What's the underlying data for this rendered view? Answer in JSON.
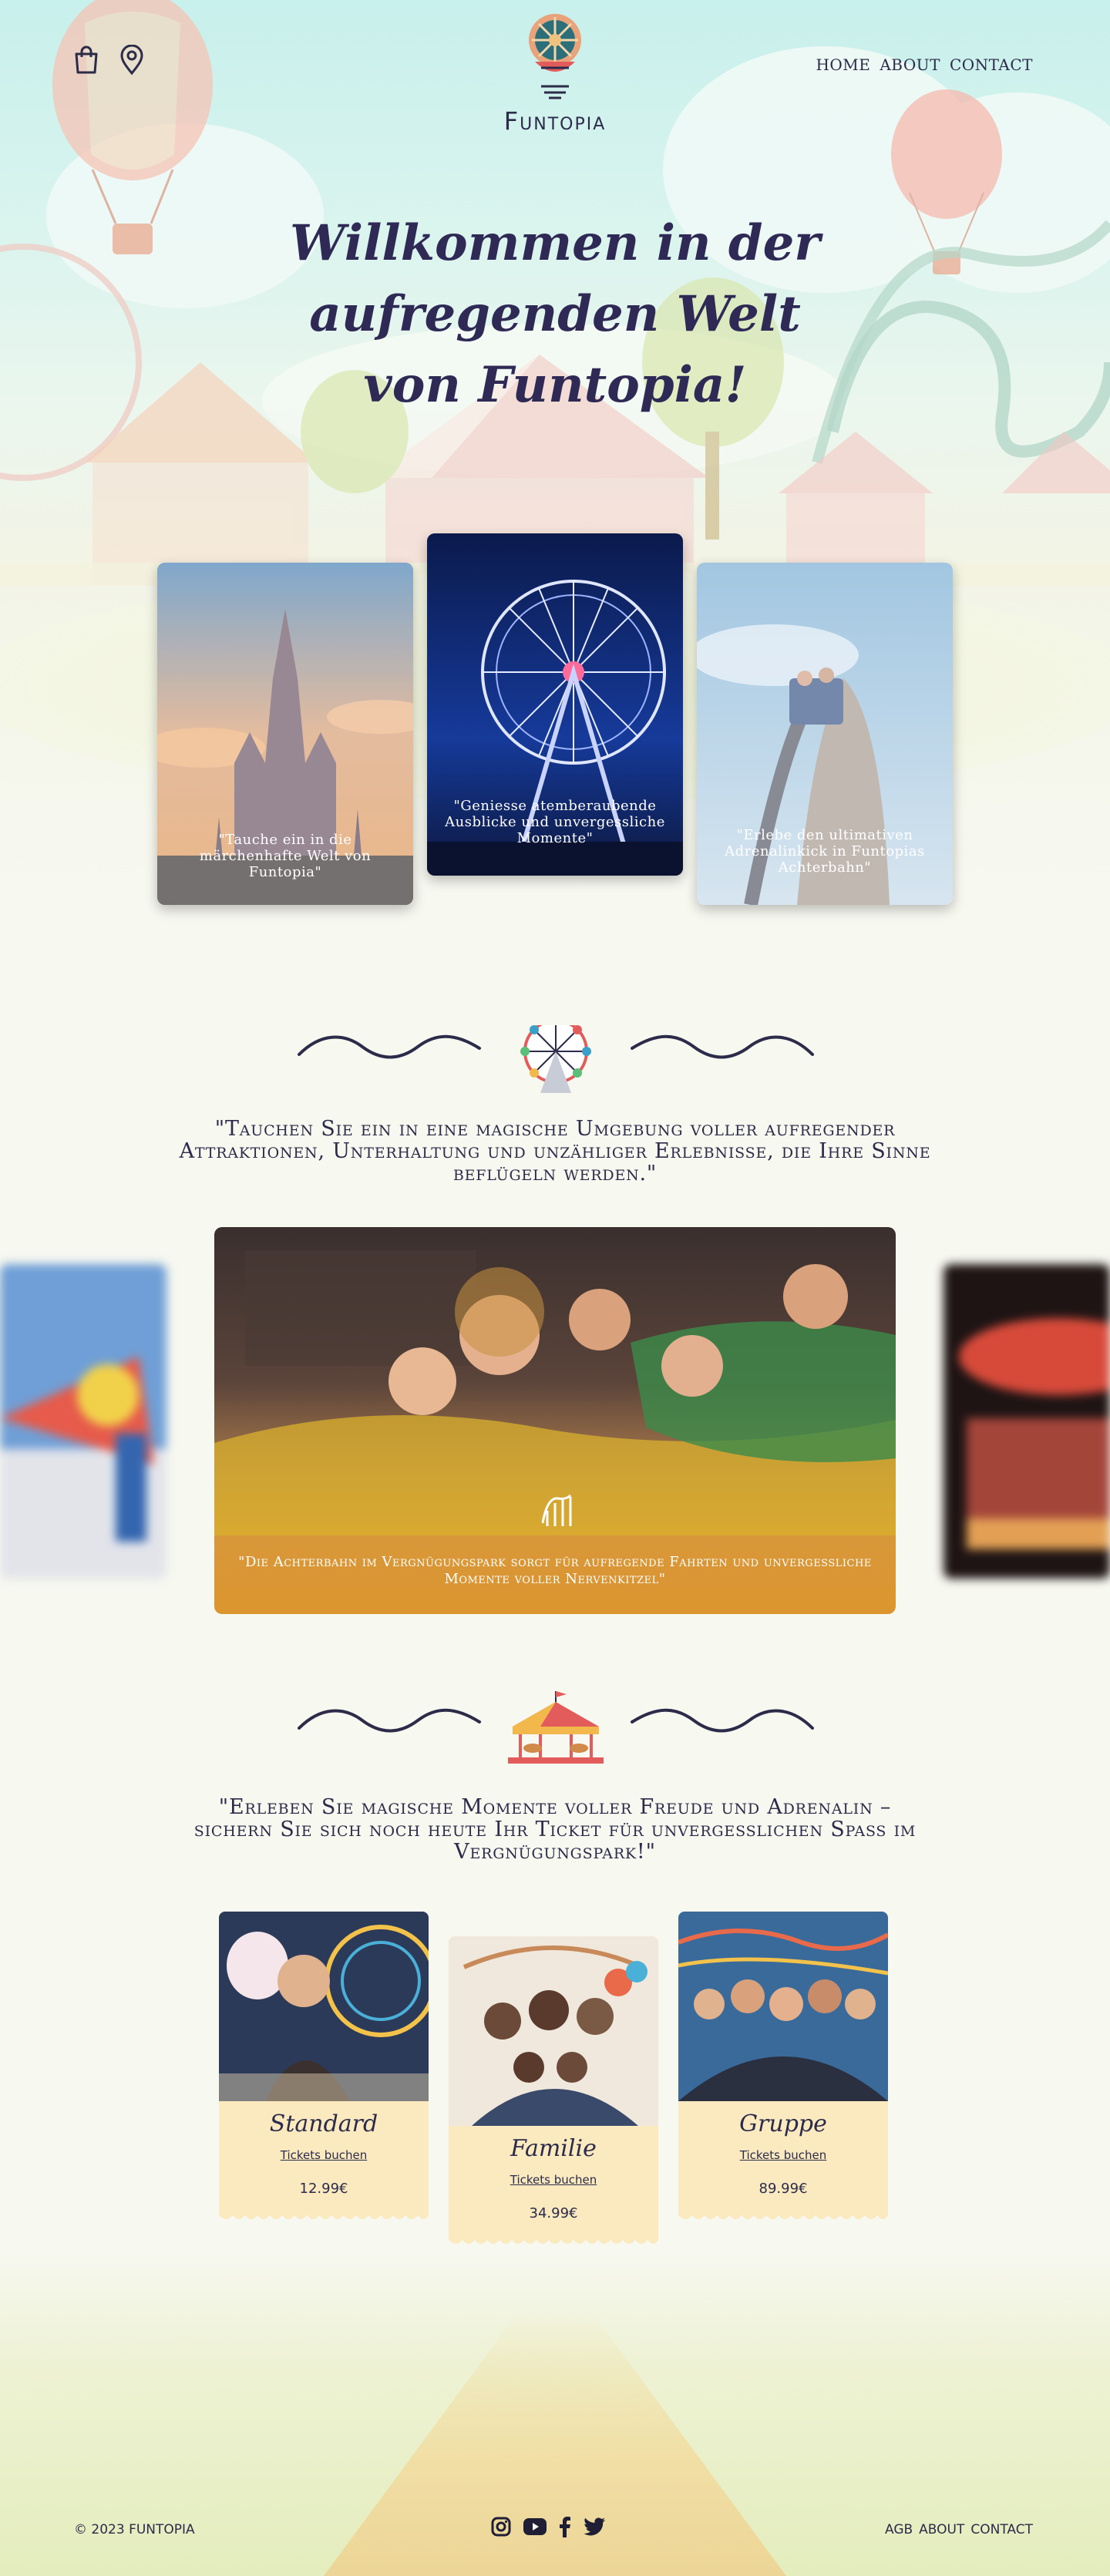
{
  "header": {
    "logo_text": "Funtopia",
    "nav": [
      "HOME",
      "ABOUT",
      "CONTACT"
    ],
    "icons": [
      "shopping-bag-icon",
      "location-pin-icon"
    ]
  },
  "hero": {
    "headline": "Willkommen in der aufregenden Welt von Funtopia!",
    "cards": [
      {
        "caption": "\"Tauche ein in die märchenhafte Welt von Funtopia\""
      },
      {
        "caption": "\"Geniesse atemberaubende Ausblicke und unvergessliche Momente\""
      },
      {
        "caption": "\"Erlebe den ultimativen Adrenalinkick in Funtopias Achterbahn\""
      }
    ]
  },
  "section1": {
    "quote": "\"Tauchen Sie ein in eine magische Umgebung voller aufregender Attraktionen, Unterhaltung und unzähliger Erlebnisse, die Ihre Sinne beflügeln werden.\""
  },
  "slider": {
    "caption": "\"Die Achterbahn im Vergnügungspark sorgt für aufregende Fahrten und unvergessliche Momente voller Nervenkitzel\""
  },
  "section2": {
    "quote": "\"Erleben Sie magische Momente voller Freude und Adrenalin – sichern Sie sich noch heute Ihr Ticket für unvergesslichen Spass im Vergnügungspark!\""
  },
  "tickets": [
    {
      "name": "Standard",
      "link": "Tickets buchen",
      "price": "12.99€"
    },
    {
      "name": "Familie",
      "link": "Tickets buchen",
      "price": "34.99€"
    },
    {
      "name": "Gruppe",
      "link": "Tickets buchen",
      "price": "89.99€"
    }
  ],
  "footer": {
    "copyright": "© 2023 FUNTOPIA",
    "links": [
      "AGB",
      "ABOUT",
      "CONTACT"
    ],
    "social": [
      "instagram-icon",
      "youtube-icon",
      "facebook-icon",
      "twitter-icon"
    ]
  },
  "colors": {
    "navy": "#2c2b4a",
    "ticket": "#fbeac0",
    "slider_gradient": "#d89a3a"
  }
}
